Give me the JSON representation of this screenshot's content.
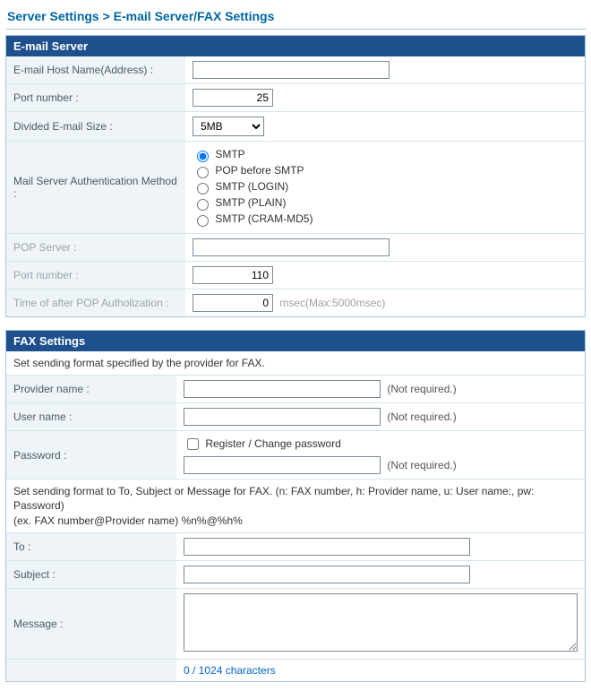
{
  "breadcrumb": "Server Settings > E-mail Server/FAX Settings",
  "email": {
    "header": "E-mail Server",
    "host_label": "E-mail Host Name(Address) :",
    "host_value": "",
    "port_label": "Port number :",
    "port_value": "25",
    "size_label": "Divided E-mail Size :",
    "size_value": "5MB",
    "size_options": [
      "5MB"
    ],
    "auth_label": "Mail Server Authentication Method :",
    "auth_options": [
      "SMTP",
      "POP before SMTP",
      "SMTP (LOGIN)",
      "SMTP (PLAIN)",
      "SMTP (CRAM-MD5)"
    ],
    "auth_selected": "SMTP",
    "pop_server_label": "POP Server :",
    "pop_server_value": "",
    "pop_port_label": "Port number :",
    "pop_port_value": "110",
    "pop_time_label": "Time of after POP Autholization :",
    "pop_time_value": "0",
    "pop_time_after": "msec(Max:5000msec)"
  },
  "fax": {
    "header": "FAX Settings",
    "desc1": "Set sending format specified by the provider for FAX.",
    "provider_label": "Provider name :",
    "provider_value": "",
    "user_label": "User name :",
    "user_value": "",
    "password_label": "Password :",
    "register_label": "Register / Change password",
    "password_value": "",
    "not_required": "(Not required.)",
    "desc2": "Set sending format to To, Subject or Message for FAX. (n: FAX number, h: Provider name, u: User name:, pw: Password)\n(ex. FAX number@Provider name) %n%@%h%",
    "to_label": "To :",
    "to_value": "",
    "subject_label": "Subject :",
    "subject_value": "",
    "message_label": "Message :",
    "message_value": "",
    "counter": "0 / 1024 characters"
  }
}
